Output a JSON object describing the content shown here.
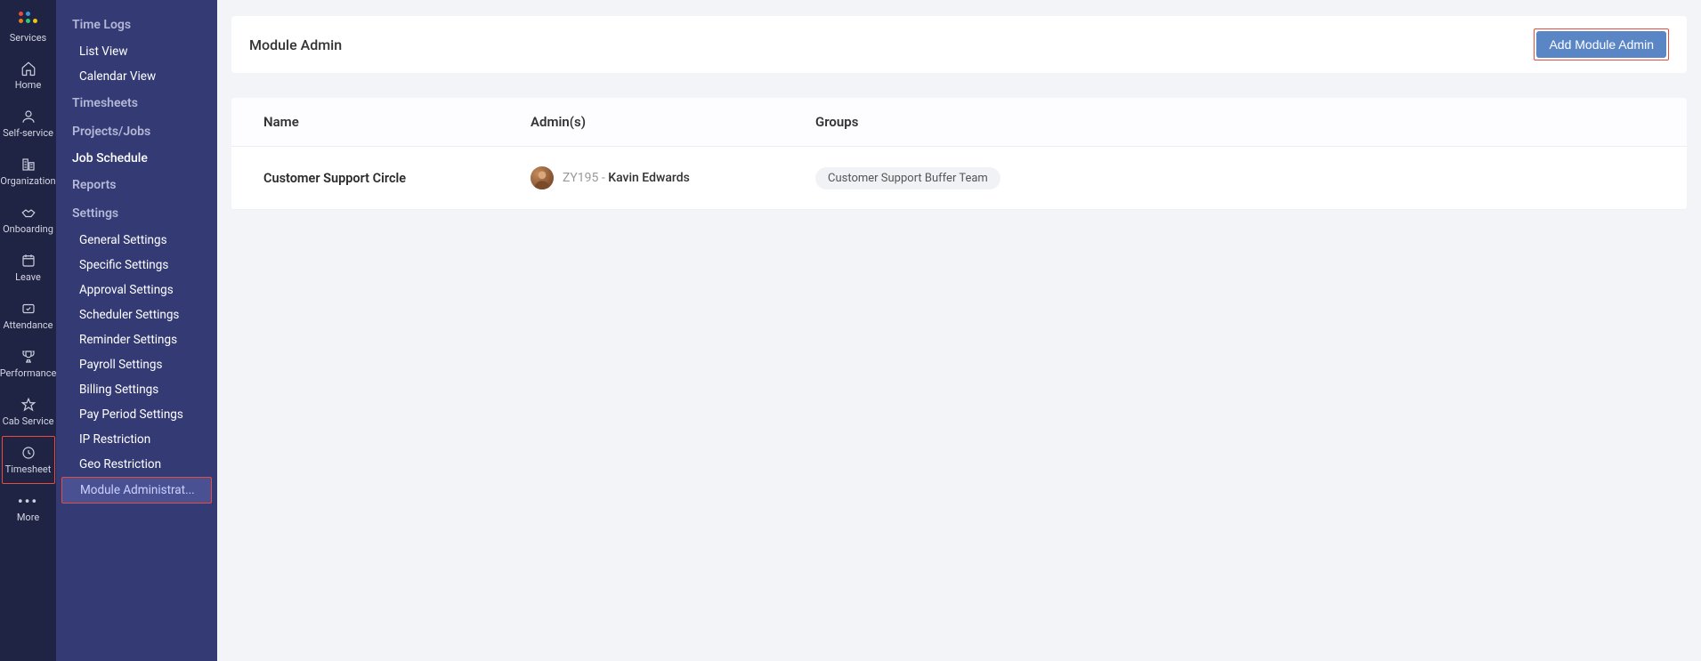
{
  "rail": {
    "items": [
      {
        "label": "Services"
      },
      {
        "label": "Home"
      },
      {
        "label": "Self-service"
      },
      {
        "label": "Organization"
      },
      {
        "label": "Onboarding"
      },
      {
        "label": "Leave"
      },
      {
        "label": "Attendance"
      },
      {
        "label": "Performance"
      },
      {
        "label": "Cab Service"
      },
      {
        "label": "Timesheet"
      },
      {
        "label": "More"
      }
    ]
  },
  "sidebar": {
    "sections": [
      {
        "title": "Time Logs",
        "items": [
          "List View",
          "Calendar View"
        ]
      },
      {
        "title": "Timesheets",
        "items": []
      },
      {
        "title": "Projects/Jobs",
        "items": []
      }
    ],
    "jobSchedule": "Job Schedule",
    "reports": "Reports",
    "settingsTitle": "Settings",
    "settingsItems": [
      "General Settings",
      "Specific Settings",
      "Approval Settings",
      "Scheduler Settings",
      "Reminder Settings",
      "Payroll Settings",
      "Billing Settings",
      "Pay Period Settings",
      "IP Restriction",
      "Geo Restriction",
      "Module Administrat..."
    ]
  },
  "main": {
    "title": "Module Admin",
    "addButton": "Add Module Admin",
    "columns": {
      "name": "Name",
      "admins": "Admin(s)",
      "groups": "Groups"
    },
    "rows": [
      {
        "name": "Customer Support Circle",
        "adminCode": "ZY195",
        "adminSep": " - ",
        "adminName": "Kavin Edwards",
        "group": "Customer Support Buffer Team"
      }
    ]
  },
  "logoColors": [
    "#e74c3c",
    "#3498db",
    "#e67e22",
    "#2ecc71",
    "#f1c40f"
  ]
}
